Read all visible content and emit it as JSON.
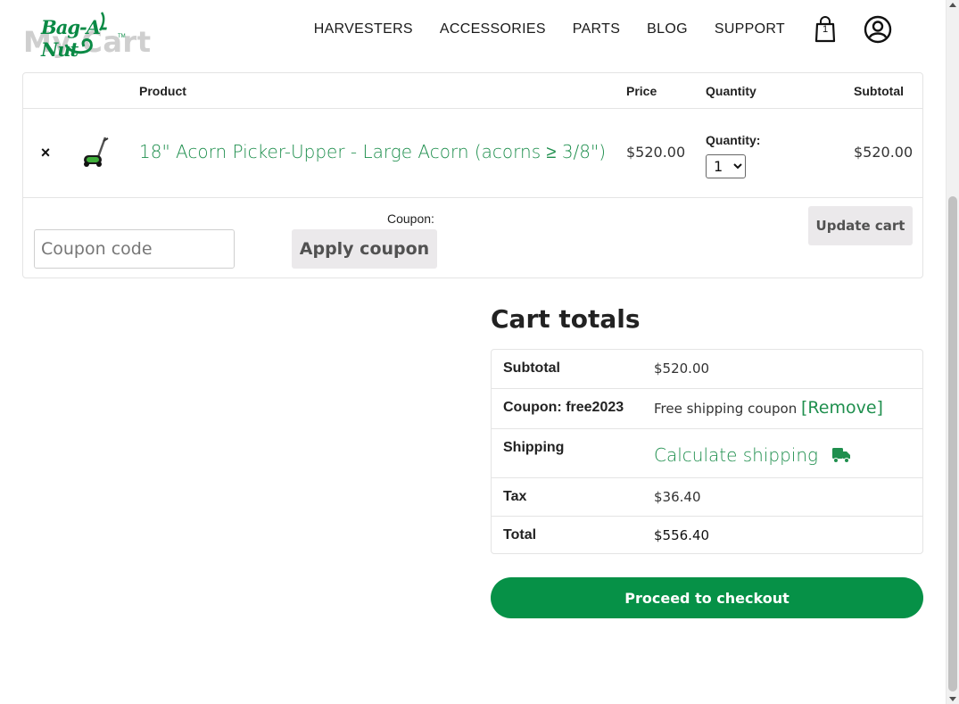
{
  "page": {
    "heading": "My Cart"
  },
  "header": {
    "logo_text": "Bag-A-Nut",
    "logo_tm": "TM",
    "nav": [
      "HARVESTERS",
      "ACCESSORIES",
      "PARTS",
      "BLOG",
      "SUPPORT"
    ],
    "cart_count": "1"
  },
  "cart": {
    "columns": {
      "product": "Product",
      "price": "Price",
      "quantity": "Quantity",
      "subtotal": "Subtotal"
    },
    "item": {
      "remove": "×",
      "name": "18\" Acorn Picker-Upper - Large Acorn (acorns ≥ 3/8\")",
      "price": "$520.00",
      "quantity_label": "Quantity:",
      "quantity": "1",
      "subtotal": "$520.00"
    },
    "coupon_label": "Coupon:",
    "coupon_placeholder": "Coupon code",
    "apply_coupon": "Apply coupon",
    "update_cart": "Update cart"
  },
  "totals": {
    "title": "Cart totals",
    "subtotal_label": "Subtotal",
    "subtotal": "$520.00",
    "coupon_label": "Coupon: free2023",
    "coupon_value": "Free shipping coupon",
    "coupon_remove": "[Remove]",
    "shipping_label": "Shipping",
    "shipping_link": "Calculate shipping",
    "tax_label": "Tax",
    "tax": "$36.40",
    "total_label": "Total",
    "total": "$556.40",
    "checkout": "Proceed to checkout"
  },
  "colors": {
    "brand_green": "#069147",
    "link_green": "#1f8f4e",
    "button_gray": "#ebe9eb"
  }
}
